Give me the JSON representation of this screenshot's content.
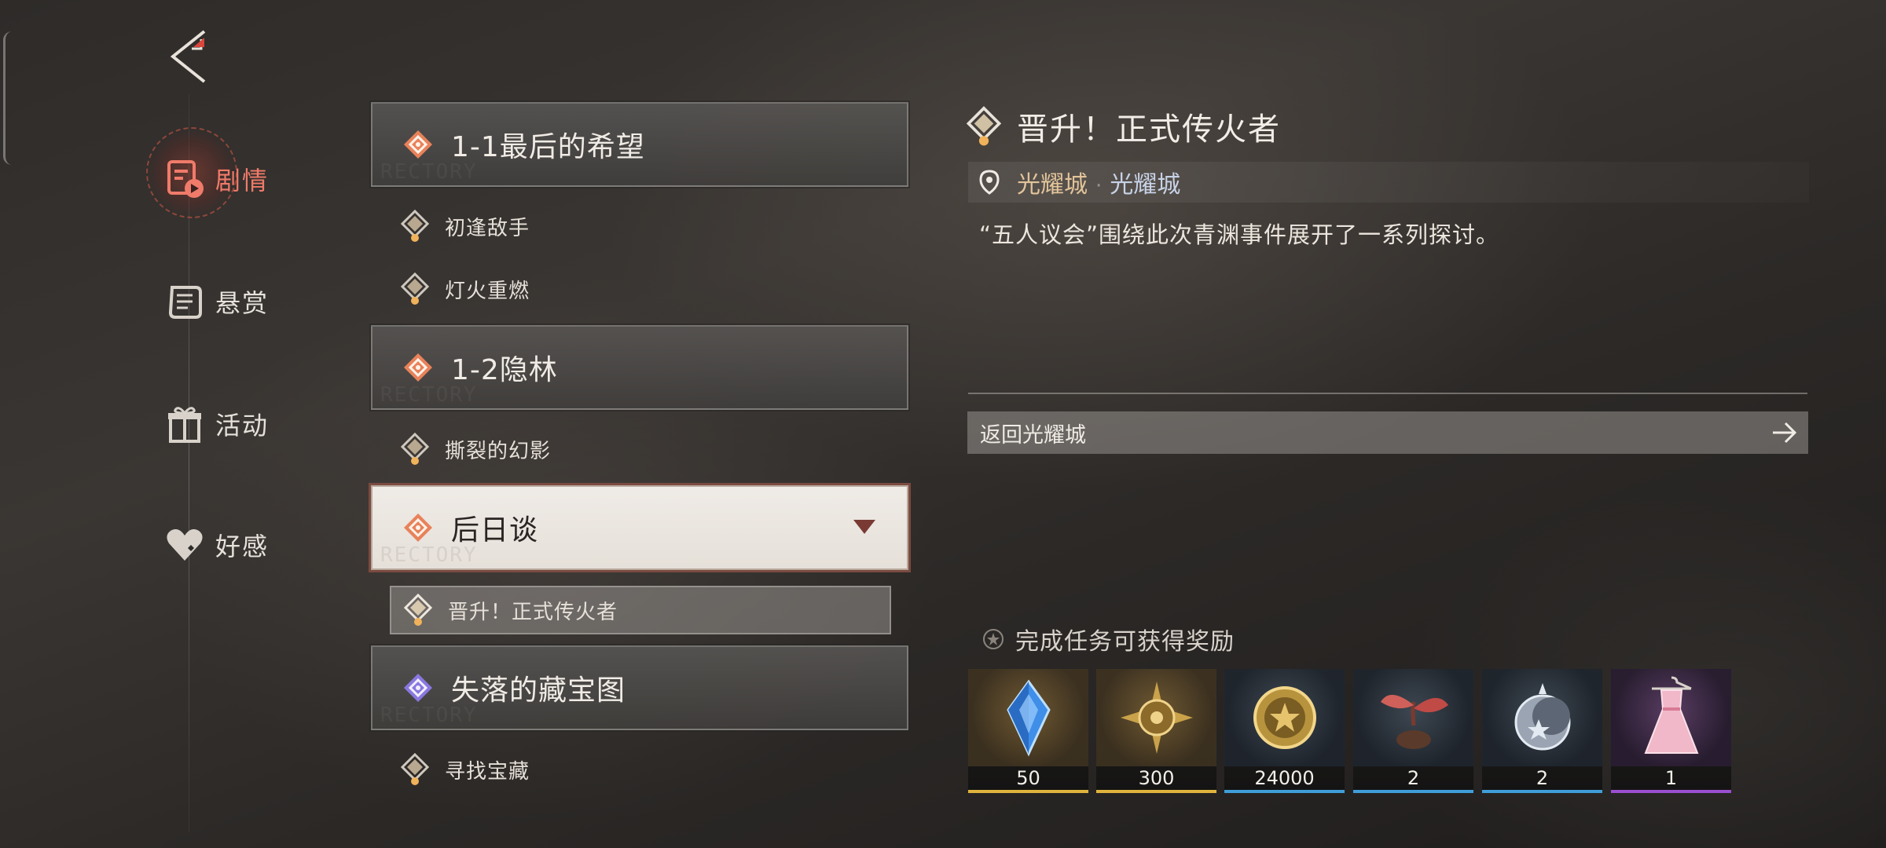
{
  "nav": {
    "back_icon": "back-arrow-icon",
    "items": [
      {
        "label": "剧情",
        "icon": "story-icon",
        "active": true
      },
      {
        "label": "悬赏",
        "icon": "scroll-icon",
        "active": false
      },
      {
        "label": "活动",
        "icon": "gift-icon",
        "active": false
      },
      {
        "label": "好感",
        "icon": "heart-icon",
        "active": false
      }
    ]
  },
  "chapters": [
    {
      "label": "1-1最后的希望",
      "watermark": "RECTORY",
      "subs": [
        "初逢敌手",
        "灯火重燃"
      ]
    },
    {
      "label": "1-2隐林",
      "watermark": "RECTORY",
      "subs": [
        "撕裂的幻影"
      ]
    },
    {
      "label": "后日谈",
      "watermark": "RECTORY",
      "open": true,
      "subs": [
        "晋升！正式传火者"
      ]
    },
    {
      "label": "失落的藏宝图",
      "watermark": "RECTORY",
      "subs": [
        "寻找宝藏"
      ]
    }
  ],
  "detail": {
    "title": "晋升！正式传火者",
    "location_city": "光耀城",
    "location_separator": "·",
    "location_area": "光耀城",
    "description": "“五人议会”围绕此次青渊事件展开了一系列探讨。",
    "return_button": "返回光耀城",
    "rewards_title": "完成任务可获得奖励"
  },
  "rewards": [
    {
      "icon": "blue-crystal-icon",
      "qty": "50",
      "rarity_color": "#e0b43c"
    },
    {
      "icon": "gold-star-orb-icon",
      "qty": "300",
      "rarity_color": "#e0b43c"
    },
    {
      "icon": "gold-coin-icon",
      "qty": "24000",
      "rarity_color": "#3f9ed8"
    },
    {
      "icon": "red-sprout-icon",
      "qty": "2",
      "rarity_color": "#3f9ed8"
    },
    {
      "icon": "silver-moon-orb-icon",
      "qty": "2",
      "rarity_color": "#3f9ed8"
    },
    {
      "icon": "pink-dress-icon",
      "qty": "1",
      "rarity_color": "#9a4fd0"
    }
  ],
  "colors": {
    "active_nav": "#f07b6a",
    "location_city": "#e2c49a",
    "location_area": "#c7d2e6"
  }
}
